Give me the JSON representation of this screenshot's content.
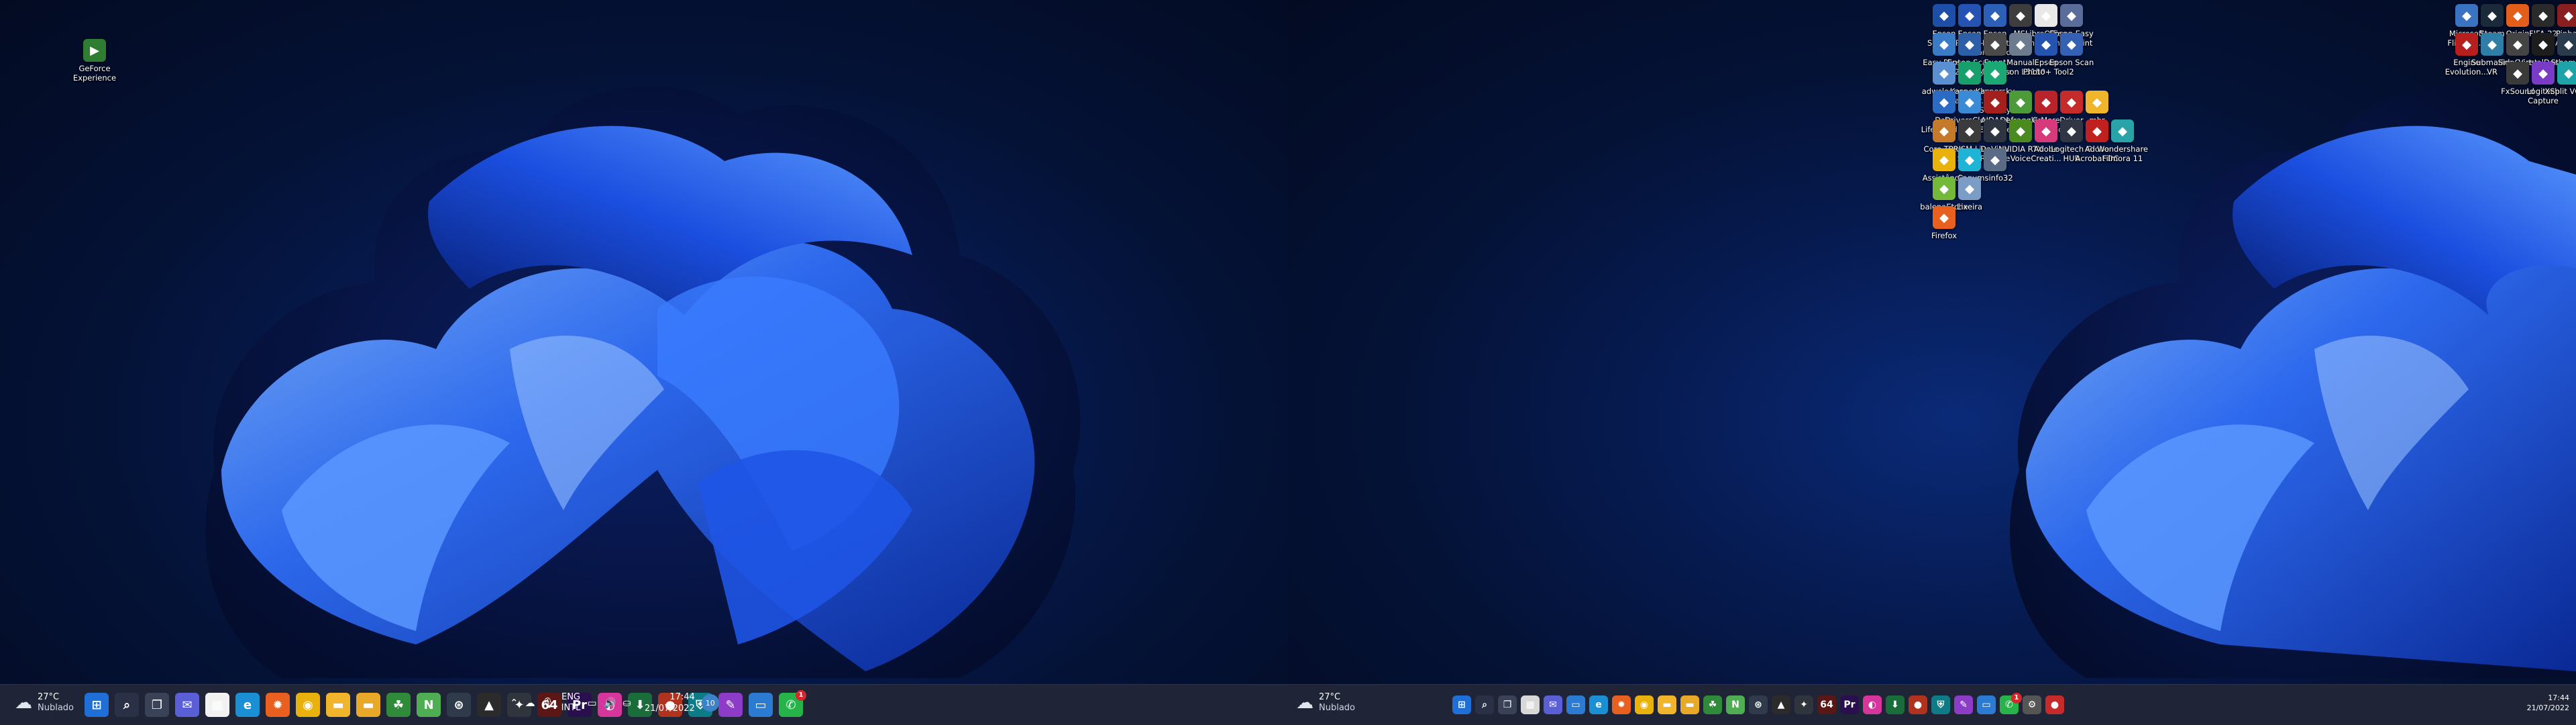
{
  "left_monitor": {
    "desktop_icons": [
      {
        "label": "GeForce Experience",
        "icon": "geforce-icon",
        "color": "#2e7d32"
      }
    ],
    "weather": {
      "temp": "27°C",
      "condition": "Nublado",
      "icon": "cloud-icon"
    },
    "taskbar_apps": [
      {
        "name": "start",
        "icon": "windows-logo-icon",
        "glyph": "⊞",
        "color": "#1f6fd8"
      },
      {
        "name": "search",
        "icon": "search-icon",
        "glyph": "⌕",
        "color": "#2a3146"
      },
      {
        "name": "task-view",
        "icon": "task-view-icon",
        "glyph": "❐",
        "color": "#3a4258"
      },
      {
        "name": "chat",
        "icon": "chat-icon",
        "glyph": "✉",
        "color": "#5b5fd6"
      },
      {
        "name": "store",
        "icon": "store-icon",
        "glyph": "▦",
        "color": "#f2f2f2"
      },
      {
        "name": "edge",
        "icon": "edge-icon",
        "glyph": "e",
        "color": "#1b8fd4"
      },
      {
        "name": "firefox",
        "icon": "firefox-icon",
        "glyph": "✹",
        "color": "#e8601f"
      },
      {
        "name": "chrome",
        "icon": "chrome-icon",
        "glyph": "◉",
        "color": "#e9b10c"
      },
      {
        "name": "file-explorer",
        "icon": "folder-icon",
        "glyph": "▬",
        "color": "#f0b52b"
      },
      {
        "name": "folder",
        "icon": "folder-icon",
        "glyph": "▬",
        "color": "#e8a928"
      },
      {
        "name": "app",
        "icon": "leaf-icon",
        "glyph": "☘",
        "color": "#2f8a3a"
      },
      {
        "name": "notepad",
        "icon": "notepad-icon",
        "glyph": "N",
        "color": "#4fae53"
      },
      {
        "name": "steam",
        "icon": "steam-icon",
        "glyph": "⊛",
        "color": "#2f3b4a"
      },
      {
        "name": "prism",
        "icon": "prism-icon",
        "glyph": "▲",
        "color": "#2b2b2b"
      },
      {
        "name": "davinci",
        "icon": "davinci-icon",
        "glyph": "✦",
        "color": "#30343c"
      },
      {
        "name": "aida",
        "icon": "aida-icon",
        "glyph": "64",
        "color": "#5b1616"
      },
      {
        "name": "premiere",
        "icon": "premiere-icon",
        "glyph": "Pr",
        "color": "#2a0f4f"
      },
      {
        "name": "creative-cloud",
        "icon": "creative-cloud-icon",
        "glyph": "◐",
        "color": "#d6369b"
      },
      {
        "name": "app2",
        "icon": "download-icon",
        "glyph": "⬇",
        "color": "#1a6c3b"
      },
      {
        "name": "app3",
        "icon": "circle-icon",
        "glyph": "●",
        "color": "#b0331f"
      },
      {
        "name": "app4",
        "icon": "shield-icon",
        "glyph": "⛨",
        "color": "#0e7c86"
      },
      {
        "name": "app5",
        "icon": "pen-icon",
        "glyph": "✎",
        "color": "#8c3cc7"
      },
      {
        "name": "remote",
        "icon": "monitor-icon",
        "glyph": "▭",
        "color": "#2a7bd1"
      },
      {
        "name": "whatsapp",
        "icon": "whatsapp-icon",
        "glyph": "✆",
        "color": "#26b34a",
        "badge": "1"
      }
    ],
    "tray": {
      "language_line1": "ENG",
      "language_line2": "INTL",
      "time": "17:44",
      "date": "21/07/2022",
      "notifications": "10"
    }
  },
  "right_monitor": {
    "desktop_icons": [
      {
        "label": "Epson Softwa...",
        "icon": "epson-software-icon",
        "color": "#1e4fa8",
        "col": 0,
        "row": 0
      },
      {
        "label": "Epson Photo+",
        "icon": "epson-photo-icon",
        "color": "#2453b3",
        "col": 1,
        "row": 0
      },
      {
        "label": "Epson Printer Connectio...",
        "icon": "epson-printer-icon",
        "color": "#2b5fb8",
        "col": 2,
        "row": 0
      },
      {
        "label": "MSI Afterburner",
        "icon": "msi-afterburner-icon",
        "color": "#3d3d3d",
        "col": 3,
        "row": 0
      },
      {
        "label": "LibreOffice 7.3",
        "icon": "libreoffice-icon",
        "color": "#e9e9e9",
        "col": 4,
        "row": 0
      },
      {
        "label": "Epson Easy Photo Print",
        "icon": "epson-easy-print-icon",
        "color": "#5a6d9a",
        "col": 5,
        "row": 0
      },
      {
        "label": "Easy Photo Scan",
        "icon": "photo-scan-icon",
        "color": "#3a7bc8",
        "col": 0,
        "row": 1
      },
      {
        "label": "Epson Scan 2 Utility",
        "icon": "epson-scan-utility-icon",
        "color": "#2d5fa8",
        "col": 1,
        "row": 1
      },
      {
        "label": "Event Manager",
        "icon": "event-manager-icon",
        "color": "#4a4a4a",
        "col": 2,
        "row": 1
      },
      {
        "label": "Manual Epson L3150",
        "icon": "manual-icon",
        "color": "#6d7b8f",
        "col": 3,
        "row": 1
      },
      {
        "label": "Epson Photo+ Tool",
        "icon": "epson-photo-tool-icon",
        "color": "#2553b0",
        "col": 4,
        "row": 1
      },
      {
        "label": "Epson Scan 2",
        "icon": "epson-scan-icon",
        "color": "#3561b5",
        "col": 5,
        "row": 1
      },
      {
        "label": "adwcleaner",
        "icon": "adwcleaner-icon",
        "color": "#5a8fd1",
        "col": 0,
        "row": 2
      },
      {
        "label": "Kaspersky Passwor...",
        "icon": "kaspersky-password-icon",
        "color": "#17a06b",
        "col": 1,
        "row": 2
      },
      {
        "label": "Kaspersky Total Security",
        "icon": "kaspersky-icon",
        "color": "#1aa875",
        "col": 2,
        "row": 2
      },
      {
        "label": "Data Lifeguard ...",
        "icon": "data-lifeguard-icon",
        "color": "#2c6bc4",
        "col": 0,
        "row": 3
      },
      {
        "label": "DriversClou... - Iniciar a a...",
        "icon": "driverscloud-icon",
        "color": "#3a8ad6",
        "col": 1,
        "row": 3
      },
      {
        "label": "AIDA64 Extreme",
        "icon": "aida64-icon",
        "color": "#a3201f",
        "col": 2,
        "row": 3
      },
      {
        "label": "Defraggler",
        "icon": "defraggler-icon",
        "color": "#4c9a3a",
        "col": 3,
        "row": 3
      },
      {
        "label": "G-More",
        "icon": "g-more-icon",
        "color": "#b8242a",
        "col": 4,
        "row": 3
      },
      {
        "label": "Driver Booster 9",
        "icon": "driver-booster-icon",
        "color": "#c62b2b",
        "col": 5,
        "row": 3
      },
      {
        "label": "mbr",
        "icon": "folder-icon",
        "color": "#f0b52b",
        "col": 6,
        "row": 3
      },
      {
        "label": "Core Temp",
        "icon": "core-temp-icon",
        "color": "#c47a2a",
        "col": 0,
        "row": 4
      },
      {
        "label": "PRISM Live Studio",
        "icon": "prism-live-icon",
        "color": "#3b3b3b",
        "col": 1,
        "row": 4
      },
      {
        "label": "DaVinci Resolve",
        "icon": "davinci-resolve-icon",
        "color": "#2e3440",
        "col": 2,
        "row": 4
      },
      {
        "label": "NVIDIA RTX Voice",
        "icon": "nvidia-icon",
        "color": "#4a8a1f",
        "col": 3,
        "row": 4
      },
      {
        "label": "Adobe Creati...",
        "icon": "adobe-cc-icon",
        "color": "#d63a7a",
        "col": 4,
        "row": 4
      },
      {
        "label": "Logitech G HUB",
        "icon": "logitech-g-icon",
        "color": "#303644",
        "col": 5,
        "row": 4
      },
      {
        "label": "Adobe Acrobat DC",
        "icon": "acrobat-icon",
        "color": "#c0211e",
        "col": 6,
        "row": 4
      },
      {
        "label": "Wondershare Filmora 11",
        "icon": "filmora-icon",
        "color": "#28a4a8",
        "col": 7,
        "row": 4
      },
      {
        "label": "Assistência Ativa",
        "icon": "chrome-icon",
        "color": "#e9b10c",
        "col": 0,
        "row": 5
      },
      {
        "label": "Canva",
        "icon": "canva-icon",
        "color": "#1fb3d6",
        "col": 1,
        "row": 5
      },
      {
        "label": "msinfo32",
        "icon": "msinfo-icon",
        "color": "#5a6b85",
        "col": 2,
        "row": 5
      },
      {
        "label": "balenaEtcher",
        "icon": "balena-icon",
        "color": "#75b93a",
        "col": 0,
        "row": 6
      },
      {
        "label": "Lixeira",
        "icon": "recycle-bin-icon",
        "color": "#7b9cc4",
        "col": 1,
        "row": 6
      },
      {
        "label": "Firefox",
        "icon": "firefox-icon",
        "color": "#e8601f",
        "col": 0,
        "row": 7
      }
    ],
    "desktop_icons_right": [
      {
        "label": "Microsoft Flight Si...",
        "icon": "flight-simulator-icon",
        "color": "#3a73c2",
        "col": 0,
        "row": 0
      },
      {
        "label": "Steam",
        "icon": "steam-icon",
        "color": "#1b2a3b",
        "col": 1,
        "row": 0
      },
      {
        "label": "Origin",
        "icon": "origin-icon",
        "color": "#e25e1a",
        "col": 2,
        "row": 0
      },
      {
        "label": "FIFA 22",
        "icon": "fifa-icon",
        "color": "#2a2a2a",
        "col": 3,
        "row": 0
      },
      {
        "label": "Pinball Arcade",
        "icon": "pinball-icon",
        "color": "#8a1f1f",
        "col": 4,
        "row": 0
      },
      {
        "label": "Engine Evolution...",
        "icon": "engine-evolution-icon",
        "color": "#b5201f",
        "col": 0,
        "row": 1
      },
      {
        "label": "Submarine VR",
        "icon": "submarine-icon",
        "color": "#2f7ea8",
        "col": 1,
        "row": 1
      },
      {
        "label": "SideQuest",
        "icon": "sidequest-icon",
        "color": "#444",
        "col": 2,
        "row": 1
      },
      {
        "label": "VirtualDesk...",
        "icon": "virtual-desktop-icon",
        "color": "#1d1d1d",
        "col": 3,
        "row": 1
      },
      {
        "label": "SteamVR",
        "icon": "steamvr-icon",
        "color": "#2a3b4e",
        "col": 4,
        "row": 1
      },
      {
        "label": "FxSound",
        "icon": "fxsound-icon",
        "color": "#3a3a3a",
        "col": 2,
        "row": 2
      },
      {
        "label": "Logitech Capture",
        "icon": "logitech-capture-icon",
        "color": "#7a3cc7",
        "col": 3,
        "row": 2
      },
      {
        "label": "XSplit VCam",
        "icon": "xsplit-icon",
        "color": "#1ea3a8",
        "col": 4,
        "row": 2
      }
    ],
    "weather": {
      "temp": "27°C",
      "condition": "Nublado",
      "icon": "cloud-icon"
    },
    "taskbar_apps": [
      {
        "name": "start",
        "icon": "windows-logo-icon",
        "glyph": "⊞",
        "color": "#1f6fd8"
      },
      {
        "name": "search",
        "icon": "search-icon",
        "glyph": "⌕",
        "color": "#2a3146"
      },
      {
        "name": "task-view",
        "icon": "task-view-icon",
        "glyph": "❐",
        "color": "#3a4258"
      },
      {
        "name": "store",
        "icon": "store-icon",
        "glyph": "▦",
        "color": "#d8d8d8"
      },
      {
        "name": "chat",
        "icon": "chat-icon",
        "glyph": "✉",
        "color": "#5b5fd6"
      },
      {
        "name": "explorer",
        "icon": "monitor-icon",
        "glyph": "▭",
        "color": "#2a7bd1"
      },
      {
        "name": "edge",
        "icon": "edge-icon",
        "glyph": "e",
        "color": "#1b8fd4"
      },
      {
        "name": "firefox",
        "icon": "firefox-icon",
        "glyph": "✹",
        "color": "#e8601f"
      },
      {
        "name": "chrome",
        "icon": "chrome-icon",
        "glyph": "◉",
        "color": "#e9b10c"
      },
      {
        "name": "file-explorer",
        "icon": "folder-icon",
        "glyph": "▬",
        "color": "#f0b52b"
      },
      {
        "name": "folder",
        "icon": "folder-icon",
        "glyph": "▬",
        "color": "#e8a928"
      },
      {
        "name": "app",
        "icon": "leaf-icon",
        "glyph": "☘",
        "color": "#2f8a3a"
      },
      {
        "name": "notepad",
        "icon": "notepad-icon",
        "glyph": "N",
        "color": "#4fae53"
      },
      {
        "name": "steam",
        "icon": "steam-icon",
        "glyph": "⊛",
        "color": "#2f3b4a"
      },
      {
        "name": "prism",
        "icon": "prism-icon",
        "glyph": "▲",
        "color": "#2b2b2b"
      },
      {
        "name": "davinci",
        "icon": "davinci-icon",
        "glyph": "✦",
        "color": "#30343c"
      },
      {
        "name": "aida",
        "icon": "aida-icon",
        "glyph": "64",
        "color": "#5b1616"
      },
      {
        "name": "premiere",
        "icon": "premiere-icon",
        "glyph": "Pr",
        "color": "#2a0f4f"
      },
      {
        "name": "creative-cloud",
        "icon": "creative-cloud-icon",
        "glyph": "◐",
        "color": "#d6369b"
      },
      {
        "name": "app2",
        "icon": "download-icon",
        "glyph": "⬇",
        "color": "#1a6c3b"
      },
      {
        "name": "app3",
        "icon": "circle-icon",
        "glyph": "●",
        "color": "#b0331f"
      },
      {
        "name": "app4",
        "icon": "shield-icon",
        "glyph": "⛨",
        "color": "#0e7c86"
      },
      {
        "name": "app5",
        "icon": "pen-icon",
        "glyph": "✎",
        "color": "#8c3cc7"
      },
      {
        "name": "remote",
        "icon": "monitor-icon",
        "glyph": "▭",
        "color": "#2a7bd1"
      },
      {
        "name": "whatsapp",
        "icon": "whatsapp-icon",
        "glyph": "✆",
        "color": "#26b34a",
        "badge": "1"
      },
      {
        "name": "app6",
        "icon": "gear-icon",
        "glyph": "⚙",
        "color": "#555"
      },
      {
        "name": "app7",
        "icon": "record-icon",
        "glyph": "●",
        "color": "#c62b2b"
      }
    ],
    "tray": {
      "time": "17:44",
      "date": "21/07/2022"
    }
  }
}
